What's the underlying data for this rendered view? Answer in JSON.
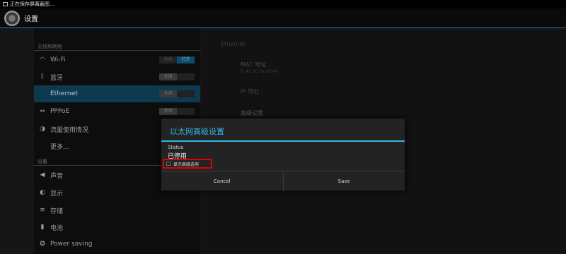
{
  "status_bar": {
    "notification_text": "正在保存屏幕截图..."
  },
  "action_bar": {
    "title": "设置"
  },
  "sidebar": {
    "section_wireless": "无线和网络",
    "section_device": "设备",
    "items": [
      {
        "label": "Wi-Fi",
        "icon": "wifi-icon",
        "toggle": {
          "off": "关闭",
          "on": "打开",
          "state": "on"
        }
      },
      {
        "label": "蓝牙",
        "icon": "bluetooth-icon",
        "toggle": {
          "off": "关闭",
          "on": "",
          "state": "off"
        }
      },
      {
        "label": "Ethernet",
        "icon": "ethernet-icon",
        "selected": true,
        "toggle": {
          "off": "关闭",
          "on": "",
          "state": "off"
        }
      },
      {
        "label": "PPPoE",
        "icon": "pppoe-icon",
        "toggle": {
          "off": "关闭",
          "on": "",
          "state": "off"
        }
      },
      {
        "label": "流量使用情况",
        "icon": "data-usage-icon"
      },
      {
        "label": "更多...",
        "icon": ""
      },
      {
        "label": "声音",
        "icon": "sound-icon"
      },
      {
        "label": "显示",
        "icon": "display-icon"
      },
      {
        "label": "存储",
        "icon": "storage-icon"
      },
      {
        "label": "电池",
        "icon": "battery-icon"
      },
      {
        "label": "Power saving",
        "icon": "power-saving-icon"
      }
    ]
  },
  "detail": {
    "title": "Ethernet",
    "mac_label": "MAC 地址",
    "mac_value": "fc:41:3c:7a:a5:40",
    "ip_label": "IP 地址",
    "advanced_label": "高级设置"
  },
  "dialog": {
    "title": "以太网高级设置",
    "status_label": "Status",
    "status_value": "已停用",
    "checkbox_label": "显示高级选项",
    "checkbox_checked": false,
    "cancel_label": "Cancel",
    "save_label": "Save"
  },
  "colors": {
    "accent": "#33b5e5",
    "highlight_border": "#e00000",
    "selected_row": "#0e3a50"
  }
}
